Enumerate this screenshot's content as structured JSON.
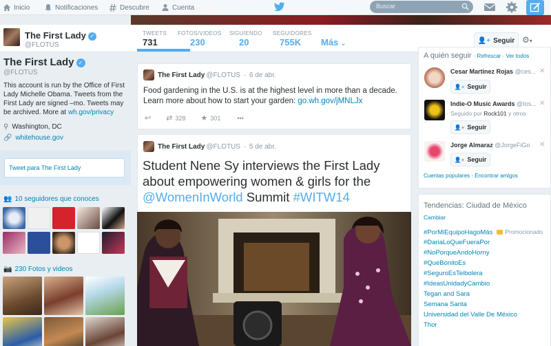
{
  "topnav": {
    "items": [
      {
        "label": "Inicio",
        "icon": "home-icon"
      },
      {
        "label": "Notificaciones",
        "icon": "bell-icon"
      },
      {
        "label": "Descubre",
        "icon": "hashtag-icon"
      },
      {
        "label": "Cuenta",
        "icon": "person-icon"
      }
    ],
    "search_placeholder": "Buscar"
  },
  "profile": {
    "name": "The First Lady",
    "handle": "@FLOTUS",
    "bio_text": "This account is run by the Office of First Lady Michelle Obama. Tweets from the First Lady are signed –mo. Tweets may be archived. More at ",
    "bio_link": "wh.gov/privacy",
    "location": "Washington, DC",
    "url": "whitehouse.gov",
    "tweet_to": "Tweet para The First Lady",
    "followers_you_know": "10 seguidores que conoces",
    "photos_videos": "230 Fotos y videos"
  },
  "stats": [
    {
      "label": "TWEETS",
      "value": "731"
    },
    {
      "label": "FOTOS/VIDEOS",
      "value": "230"
    },
    {
      "label": "SIGUIENDO",
      "value": "20"
    },
    {
      "label": "SEGUIDORES",
      "value": "755K"
    }
  ],
  "more_label": "Más",
  "follow_label": "Seguir",
  "tweets": [
    {
      "name": "The First Lady",
      "handle": "@FLOTUS",
      "date": "6 de abr.",
      "text": "Food gardening in the U.S. is at the highest level in more than a decade. Learn more about how to start your garden: ",
      "link": "go.wh.gov/jMNLJx",
      "retweets": "328",
      "favorites": "301"
    },
    {
      "name": "The First Lady",
      "handle": "@FLOTUS",
      "date": "5 de abr.",
      "text_a": "Student Nene Sy interviews the First Lady about empowering women & girls for the ",
      "mention": "@WomenInWorld",
      "text_b": " Summit ",
      "hashtag": "#WITW14"
    }
  ],
  "who_to_follow": {
    "title": "A quién seguir",
    "refresh": "Refrescar",
    "view_all": "Ver todos",
    "suggestions": [
      {
        "name": "Cesar Martinez Rojas",
        "handle": "@ces...",
        "sub": "",
        "sub_link": "",
        "sub_tail": ""
      },
      {
        "name": "Indie-O Music Awards",
        "handle": "@Ios...",
        "sub": "Seguido por ",
        "sub_link": "Rock101",
        "sub_tail": " y otros"
      },
      {
        "name": "Jorge Almaraz",
        "handle": "@JorgeFiGo",
        "sub": "",
        "sub_link": "",
        "sub_tail": ""
      }
    ],
    "popular_accounts": "Cuentas populares",
    "find_friends": "Encontrar amigos"
  },
  "trends": {
    "title": "Tendencias: Ciudad de México",
    "change": "Cambiar",
    "promoted_label": "Promocionado",
    "items": [
      "#PorMiEquipoHagoMás",
      "#DariaLoQueFueraPor",
      "#NoPorqueAndoHorny",
      "#QueBonitoEs",
      "#SeguroEsTeibolera",
      "#IdeasUnidadyCambio",
      "Tegan and Sara",
      "Semana Santa",
      "Universidad del Valle De México",
      "Thor"
    ]
  },
  "colors": {
    "accent": "#55acee",
    "link": "#0084b4",
    "text": "#292f33",
    "muted": "#8899a6"
  }
}
